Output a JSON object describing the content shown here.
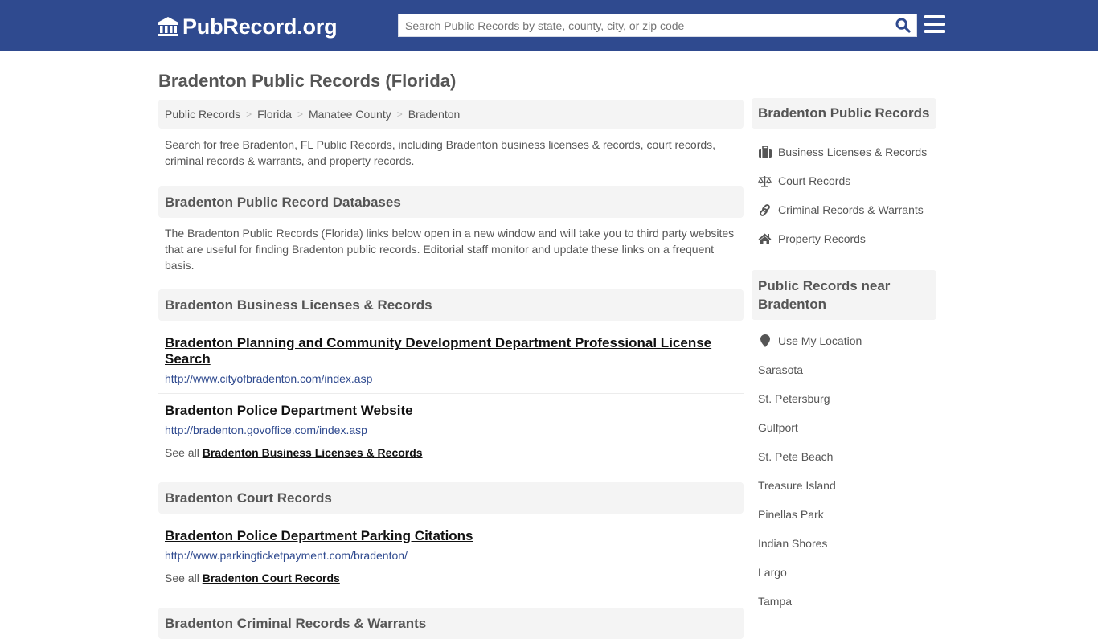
{
  "header": {
    "logo_text": "PubRecord.org",
    "search_placeholder": "Search Public Records by state, county, city, or zip code",
    "search_value": "",
    "brand_color": "#2f4a8f"
  },
  "page": {
    "title": "Bradenton Public Records (Florida)",
    "breadcrumb": [
      "Public Records",
      "Florida",
      "Manatee County",
      "Bradenton"
    ],
    "intro": "Search for free Bradenton, FL Public Records, including Bradenton business licenses & records, court records, criminal records & warrants, and property records."
  },
  "databases": {
    "header": "Bradenton Public Record Databases",
    "description": "The Bradenton Public Records (Florida) links below open in a new window and will take you to third party websites that are useful for finding Bradenton public records. Editorial staff monitor and update these links on a frequent basis."
  },
  "sections": [
    {
      "header": "Bradenton Business Licenses & Records",
      "records": [
        {
          "title": "Bradenton Planning and Community Development Department Professional License Search",
          "url": "http://www.cityofbradenton.com/index.asp"
        },
        {
          "title": "Bradenton Police Department Website",
          "url": "http://bradenton.govoffice.com/index.asp"
        }
      ],
      "see_all_prefix": "See all",
      "see_all_link": "Bradenton Business Licenses & Records"
    },
    {
      "header": "Bradenton Court Records",
      "records": [
        {
          "title": "Bradenton Police Department Parking Citations",
          "url": "http://www.parkingticketpayment.com/bradenton/"
        }
      ],
      "see_all_prefix": "See all",
      "see_all_link": "Bradenton Court Records"
    },
    {
      "header": "Bradenton Criminal Records & Warrants"
    }
  ],
  "sidebar": {
    "records_header": "Bradenton Public Records",
    "records_items": [
      {
        "label": "Business Licenses & Records",
        "icon": "briefcase-icon"
      },
      {
        "label": "Court Records",
        "icon": "scale-icon"
      },
      {
        "label": "Criminal Records & Warrants",
        "icon": "link-icon"
      },
      {
        "label": "Property Records",
        "icon": "home-icon"
      }
    ],
    "nearby_header": "Public Records near Bradenton",
    "location_label": "Use My Location",
    "nearby_cities": [
      "Sarasota",
      "St. Petersburg",
      "Gulfport",
      "St. Pete Beach",
      "Treasure Island",
      "Pinellas Park",
      "Indian Shores",
      "Largo",
      "Tampa"
    ]
  }
}
